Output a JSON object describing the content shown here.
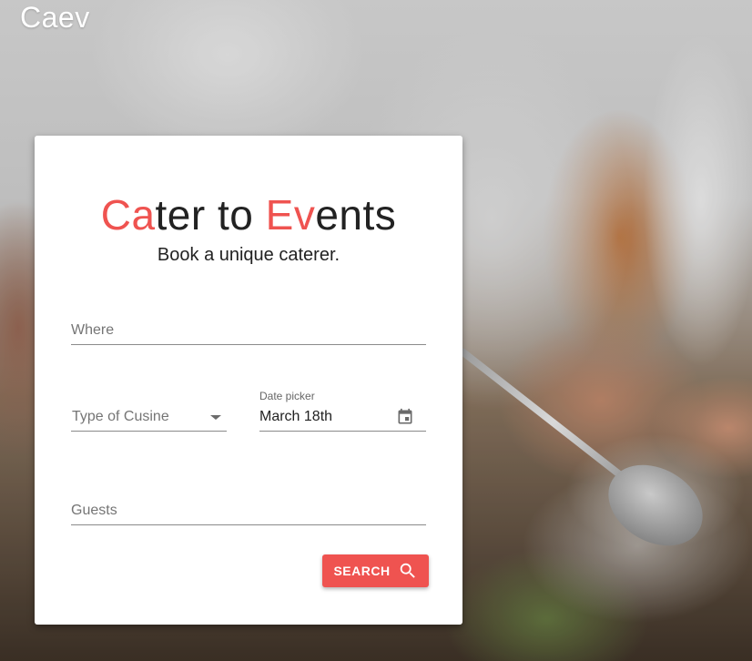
{
  "brand": {
    "name": "Caev"
  },
  "hero": {
    "title_parts": [
      "Ca",
      "ter to ",
      "Ev",
      "ents"
    ],
    "subtitle": "Book a unique caterer."
  },
  "form": {
    "where": {
      "placeholder": "Where",
      "value": ""
    },
    "cuisine": {
      "placeholder": "Type of Cusine",
      "icon": "chevron-down-icon"
    },
    "date": {
      "label": "Date picker",
      "value": "March 18th",
      "icon": "calendar-icon"
    },
    "guests": {
      "placeholder": "Guests",
      "value": ""
    },
    "search_button": {
      "label": "SEARCH",
      "icon": "search-icon"
    }
  },
  "colors": {
    "accent": "#ef5350",
    "text": "#222222",
    "card": "#ffffff"
  }
}
